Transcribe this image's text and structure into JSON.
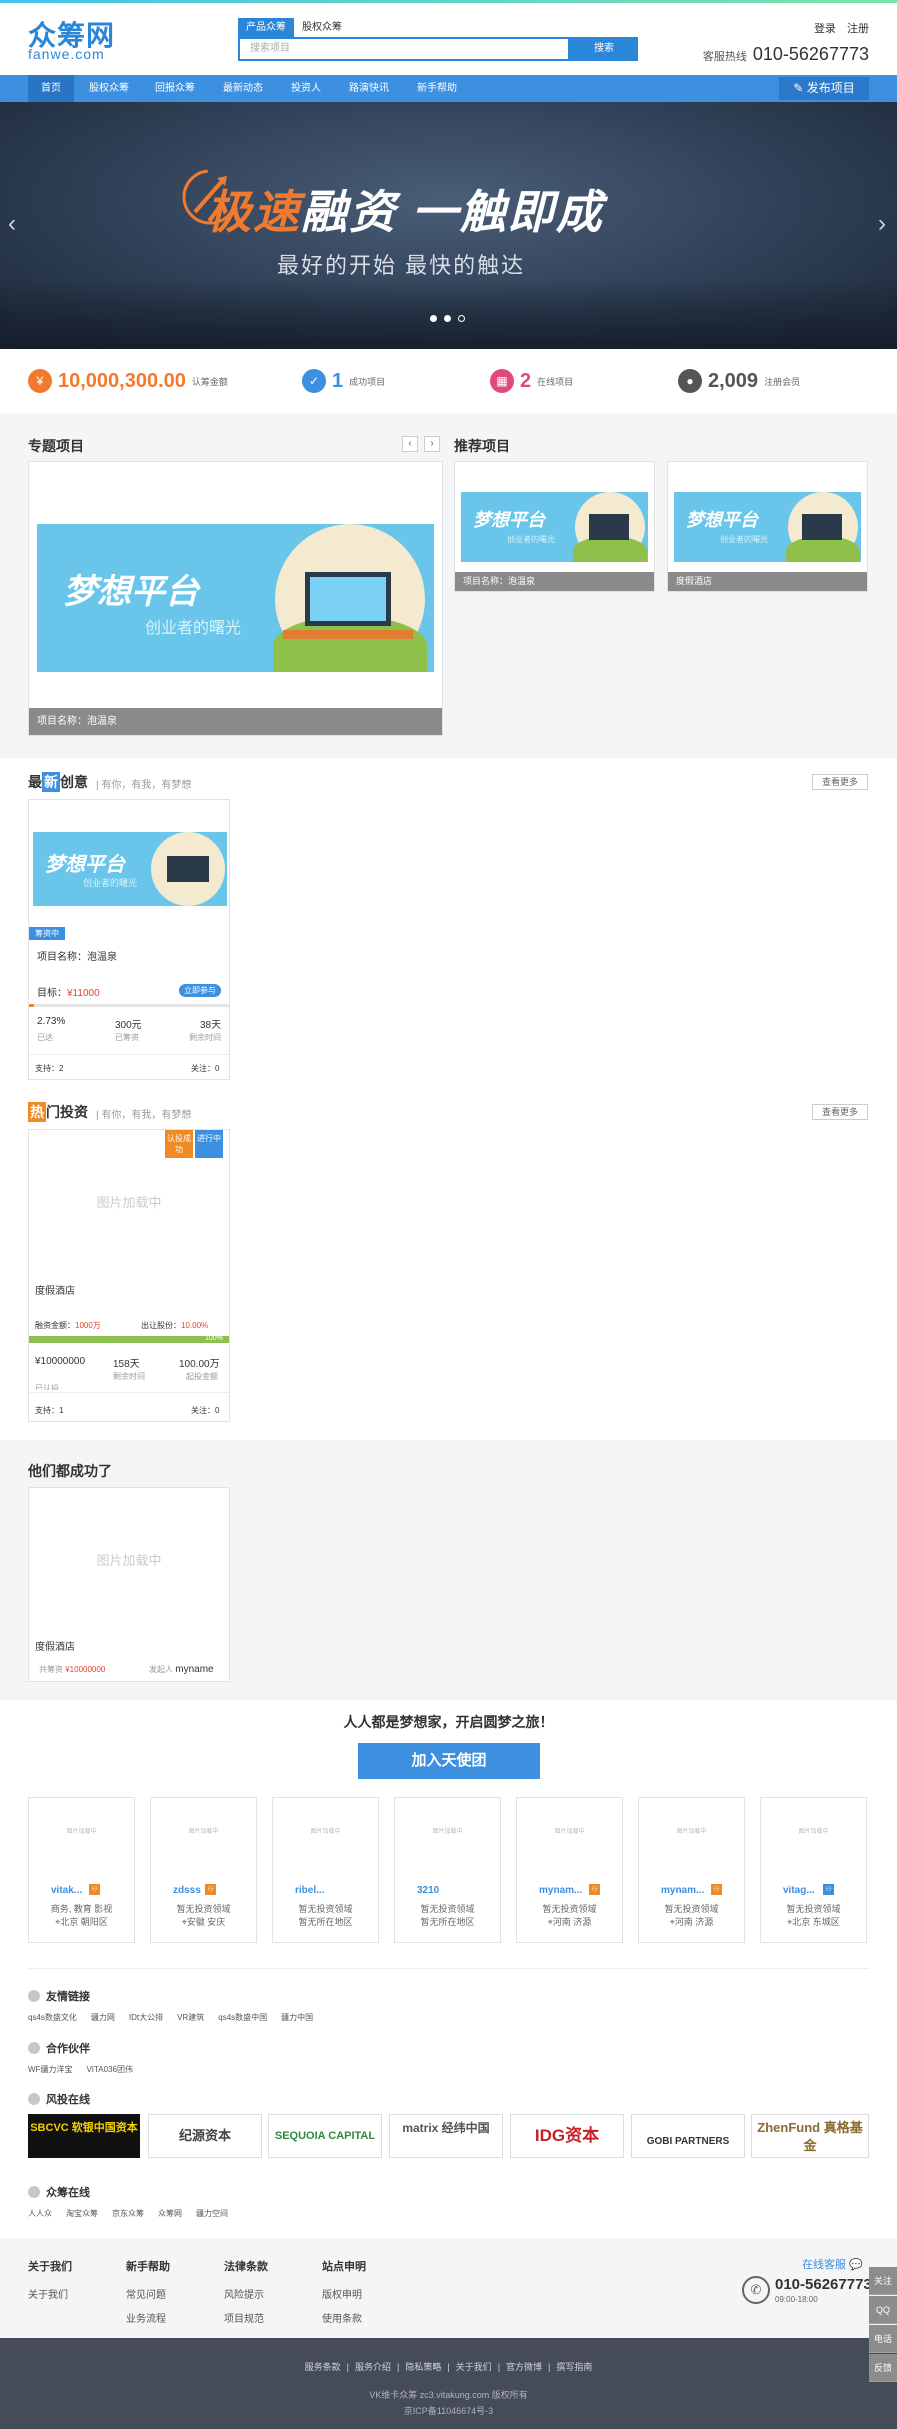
{
  "header": {
    "logo_cn": "众筹网",
    "logo_en": "fanwe.com",
    "search_tabs": [
      "产品众筹",
      "股权众筹"
    ],
    "search_placeholder": "搜索项目",
    "search_button": "搜索",
    "login": "登录",
    "register": "注册",
    "hotline_label": "客服热线",
    "hotline_number": "010-56267773"
  },
  "nav": {
    "items": [
      "首页",
      "股权众筹",
      "回报众筹",
      "最新动态",
      "投资人",
      "路演快讯",
      "新手帮助"
    ],
    "publish": "发布项目"
  },
  "banner": {
    "title_highlight": "极速",
    "title_rest": "融资 一触即成",
    "subtitle": "最好的开始 最快的触达",
    "slide_count": 3,
    "active_slide": 3
  },
  "stats": [
    {
      "value": "10,000,300.00",
      "label": "认筹金额",
      "icon": "money-icon",
      "color": "#f27a2e"
    },
    {
      "value": "1",
      "label": "成功项目",
      "icon": "success-icon",
      "color": "#3d8fe0"
    },
    {
      "value": "2",
      "label": "在线项目",
      "icon": "grid-icon",
      "color": "#e04a7a"
    },
    {
      "value": "2,009",
      "label": "注册会员",
      "icon": "user-icon",
      "color": "#555555"
    }
  ],
  "topics": {
    "title": "专题项目",
    "caption": "项目名称：泡温泉",
    "image_title": "梦想平台",
    "image_sub": "创业者的曙光"
  },
  "recommend": {
    "title": "推荐项目",
    "items": [
      {
        "caption": "项目名称：泡温泉",
        "image_title": "梦想平台",
        "image_sub": "创业者的曙光"
      },
      {
        "caption": "度假酒店",
        "image_title": "梦想平台",
        "image_sub": "创业者的曙光"
      }
    ]
  },
  "creative": {
    "title_pre": "最",
    "title_badge": "新",
    "title_post": "创意",
    "note": "| 有你，有我，有梦想",
    "more": "查看更多",
    "card": {
      "image_title": "梦想平台",
      "image_sub": "创业者的曙光",
      "status": "筹资中",
      "name": "项目名称：泡温泉",
      "target_label": "目标：",
      "target_value": "¥11000",
      "join": "立即参与",
      "progress": 0.0273,
      "m1_value": "2.73%",
      "m1_label": "已达",
      "m2_value": "300元",
      "m2_label": "已筹资",
      "m3_value": "38天",
      "m3_label": "剩余时间",
      "support": "支持：2",
      "follow": "关注：0"
    }
  },
  "hot": {
    "title_badge": "热",
    "title_post": "门投资",
    "note": "| 有你，有我，有梦想",
    "more": "查看更多",
    "card": {
      "tag1": "认投成功",
      "tag2": "进行中",
      "placeholder": "图片加载中",
      "name": "度假酒店",
      "raise_label": "融资金额：",
      "raise_value": "1000万",
      "share_label": "出让股份：",
      "share_value": "10.00%",
      "progress": 1.0,
      "progress_text": "100%",
      "m1_value": "¥10000000",
      "m1_label": "已认投",
      "m2_value": "158天",
      "m2_label": "剩余时间",
      "m3_value": "100.00万",
      "m3_label": "起投金额",
      "support": "支持：1",
      "follow": "关注：0"
    }
  },
  "success": {
    "title": "他们都成功了",
    "placeholder": "图片加载中",
    "name": "度假酒店",
    "amount_label": "共筹资",
    "amount_value": "¥10000000",
    "initiator_label": "发起人",
    "initiator_value": "myname"
  },
  "join": {
    "slogan": "人人都是梦想家，开启圆梦之旅！",
    "button": "加入天使团",
    "members": [
      {
        "name": "vitak...",
        "l1": "商务, 教育 影视",
        "l2": "北京 朝阳区",
        "icon": "orange"
      },
      {
        "name": "zdsss",
        "l1": "暂无投资领域",
        "l2": "安徽 安庆",
        "icon": "orange"
      },
      {
        "name": "ribel...",
        "l1": "暂无投资领域",
        "l2": "暂无所在地区",
        "icon": "none"
      },
      {
        "name": "3210",
        "l1": "暂无投资领域",
        "l2": "暂无所在地区",
        "icon": "none"
      },
      {
        "name": "mynam...",
        "l1": "暂无投资领域",
        "l2": "河南 济源",
        "icon": "orange"
      },
      {
        "name": "mynam...",
        "l1": "暂无投资领域",
        "l2": "河南 济源",
        "icon": "orange"
      },
      {
        "name": "vitag...",
        "l1": "暂无投资领域",
        "l2": "北京 东城区",
        "icon": "blue"
      }
    ],
    "photo_placeholder": "图片加载中"
  },
  "friend_links": {
    "title": "友情链接",
    "items": [
      "qs4s数盛文化",
      "疆力网",
      "IDt大公排",
      "VR建筑",
      "qs4s数盛中国",
      "疆力中国"
    ]
  },
  "partners": {
    "title": "合作伙伴",
    "items": [
      "WF疆力洋宝",
      "VITA036团伟"
    ]
  },
  "vc": {
    "title": "风投在线",
    "logos": [
      "SBCVC 软银中国资本",
      "纪源资本",
      "SEQUOIA CAPITAL",
      "matrix 经纬中国",
      "IDG资本",
      "GOBI PARTNERS",
      "ZhenFund 真格基金"
    ]
  },
  "online": {
    "title": "众筹在线",
    "items": [
      "人人众",
      "淘宝众筹",
      "京东众筹",
      "众筹网",
      "疆力空间"
    ]
  },
  "help": {
    "cols": [
      {
        "title": "关于我们",
        "items": [
          "关于我们"
        ]
      },
      {
        "title": "新手帮助",
        "items": [
          "常见问题",
          "业务流程"
        ]
      },
      {
        "title": "法律条款",
        "items": [
          "风险提示",
          "项目规范"
        ]
      },
      {
        "title": "站点申明",
        "items": [
          "版权申明",
          "使用条款"
        ]
      }
    ],
    "service": "在线客服",
    "phone": "010-56267773",
    "hours": "09:00-18:00"
  },
  "footer": {
    "links": [
      "服务条款",
      "服务介绍",
      "隐私策略",
      "关于我们",
      "官方微博",
      "撰写指南"
    ],
    "copyright": "VK维卡众筹 zc3.vitakung.com 版权所有",
    "icp": "京ICP备11046674号-3"
  },
  "side_tools": [
    "关注",
    "QQ",
    "电话",
    "反馈"
  ]
}
